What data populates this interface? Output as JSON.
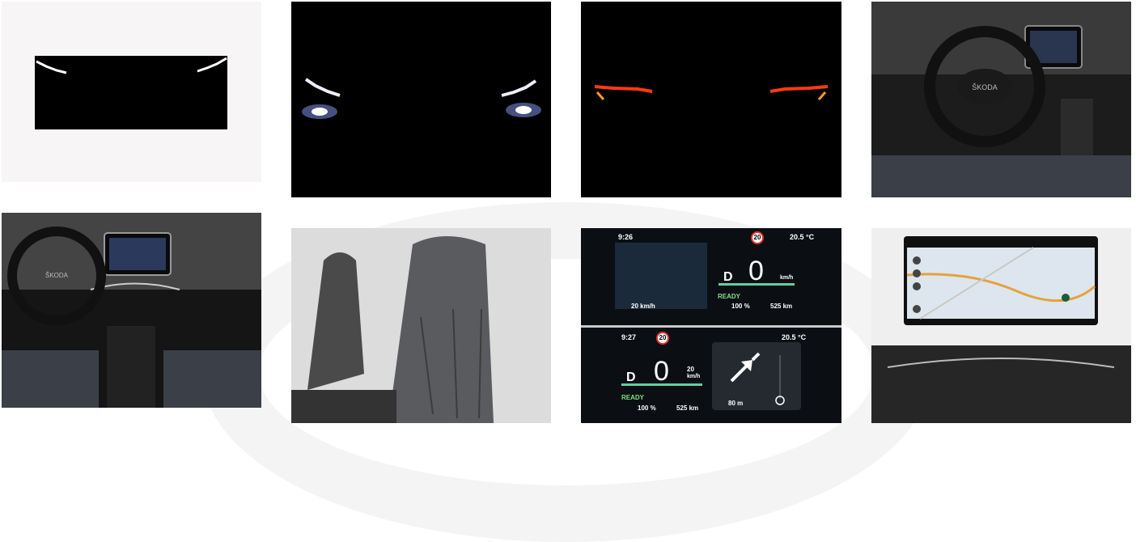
{
  "cluster_top": {
    "time": "9:26",
    "temp": "20.5 °C",
    "speed_limit": "20",
    "gear": "D",
    "speed": "0",
    "unit": "km/h",
    "acc_speed": "20 km/h",
    "ready": "READY",
    "battery": "100 %",
    "range": "525 km"
  },
  "cluster_bottom": {
    "time": "9:27",
    "temp": "20.5 °C",
    "speed_limit": "20",
    "gear": "D",
    "speed": "0",
    "acc_speed": "20",
    "acc_unit": "km/h",
    "ready": "READY",
    "battery": "100 %",
    "range": "525 km",
    "nav_distance": "80 m"
  },
  "steering_badge": "ŠKODA"
}
